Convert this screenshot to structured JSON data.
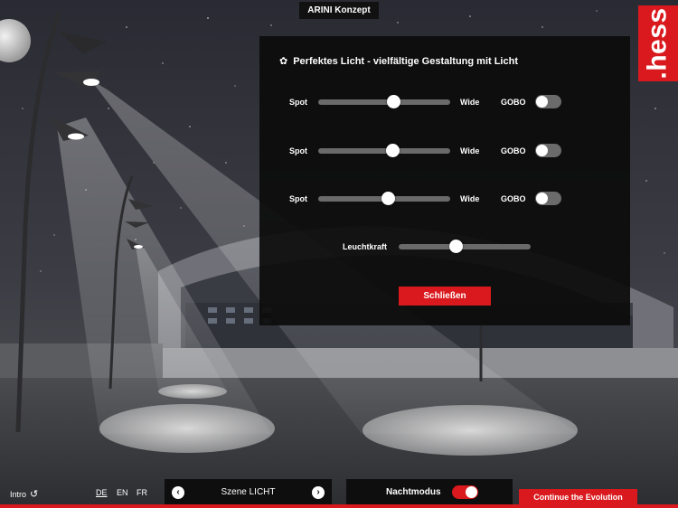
{
  "header": {
    "title": "ARINI Konzept"
  },
  "brand": {
    "logo_text": ".hess",
    "accent_color": "#d9191d"
  },
  "panel": {
    "title": "Perfektes Licht - vielfältige Gestaltung mit Licht",
    "title_icon": "gear-icon",
    "beam_rows": [
      {
        "left_label": "Spot",
        "right_label": "Wide",
        "value": 0.57,
        "gobo_label": "GOBO",
        "gobo_on": false
      },
      {
        "left_label": "Spot",
        "right_label": "Wide",
        "value": 0.56,
        "gobo_label": "GOBO",
        "gobo_on": false
      },
      {
        "left_label": "Spot",
        "right_label": "Wide",
        "value": 0.53,
        "gobo_label": "GOBO",
        "gobo_on": false
      }
    ],
    "brightness": {
      "label": "Leuchtkraft",
      "value": 0.43
    },
    "close_label": "Schließen"
  },
  "footer": {
    "intro_label": "Intro",
    "intro_icon": "refresh-icon",
    "languages": [
      "DE",
      "EN",
      "FR"
    ],
    "active_language": "DE",
    "scene_label": "Szene LICHT",
    "prev_icon": "chevron-left-icon",
    "next_icon": "chevron-right-icon",
    "night_mode_label": "Nachtmodus",
    "night_mode_on": true,
    "cta_label": "Continue the Evolution"
  }
}
